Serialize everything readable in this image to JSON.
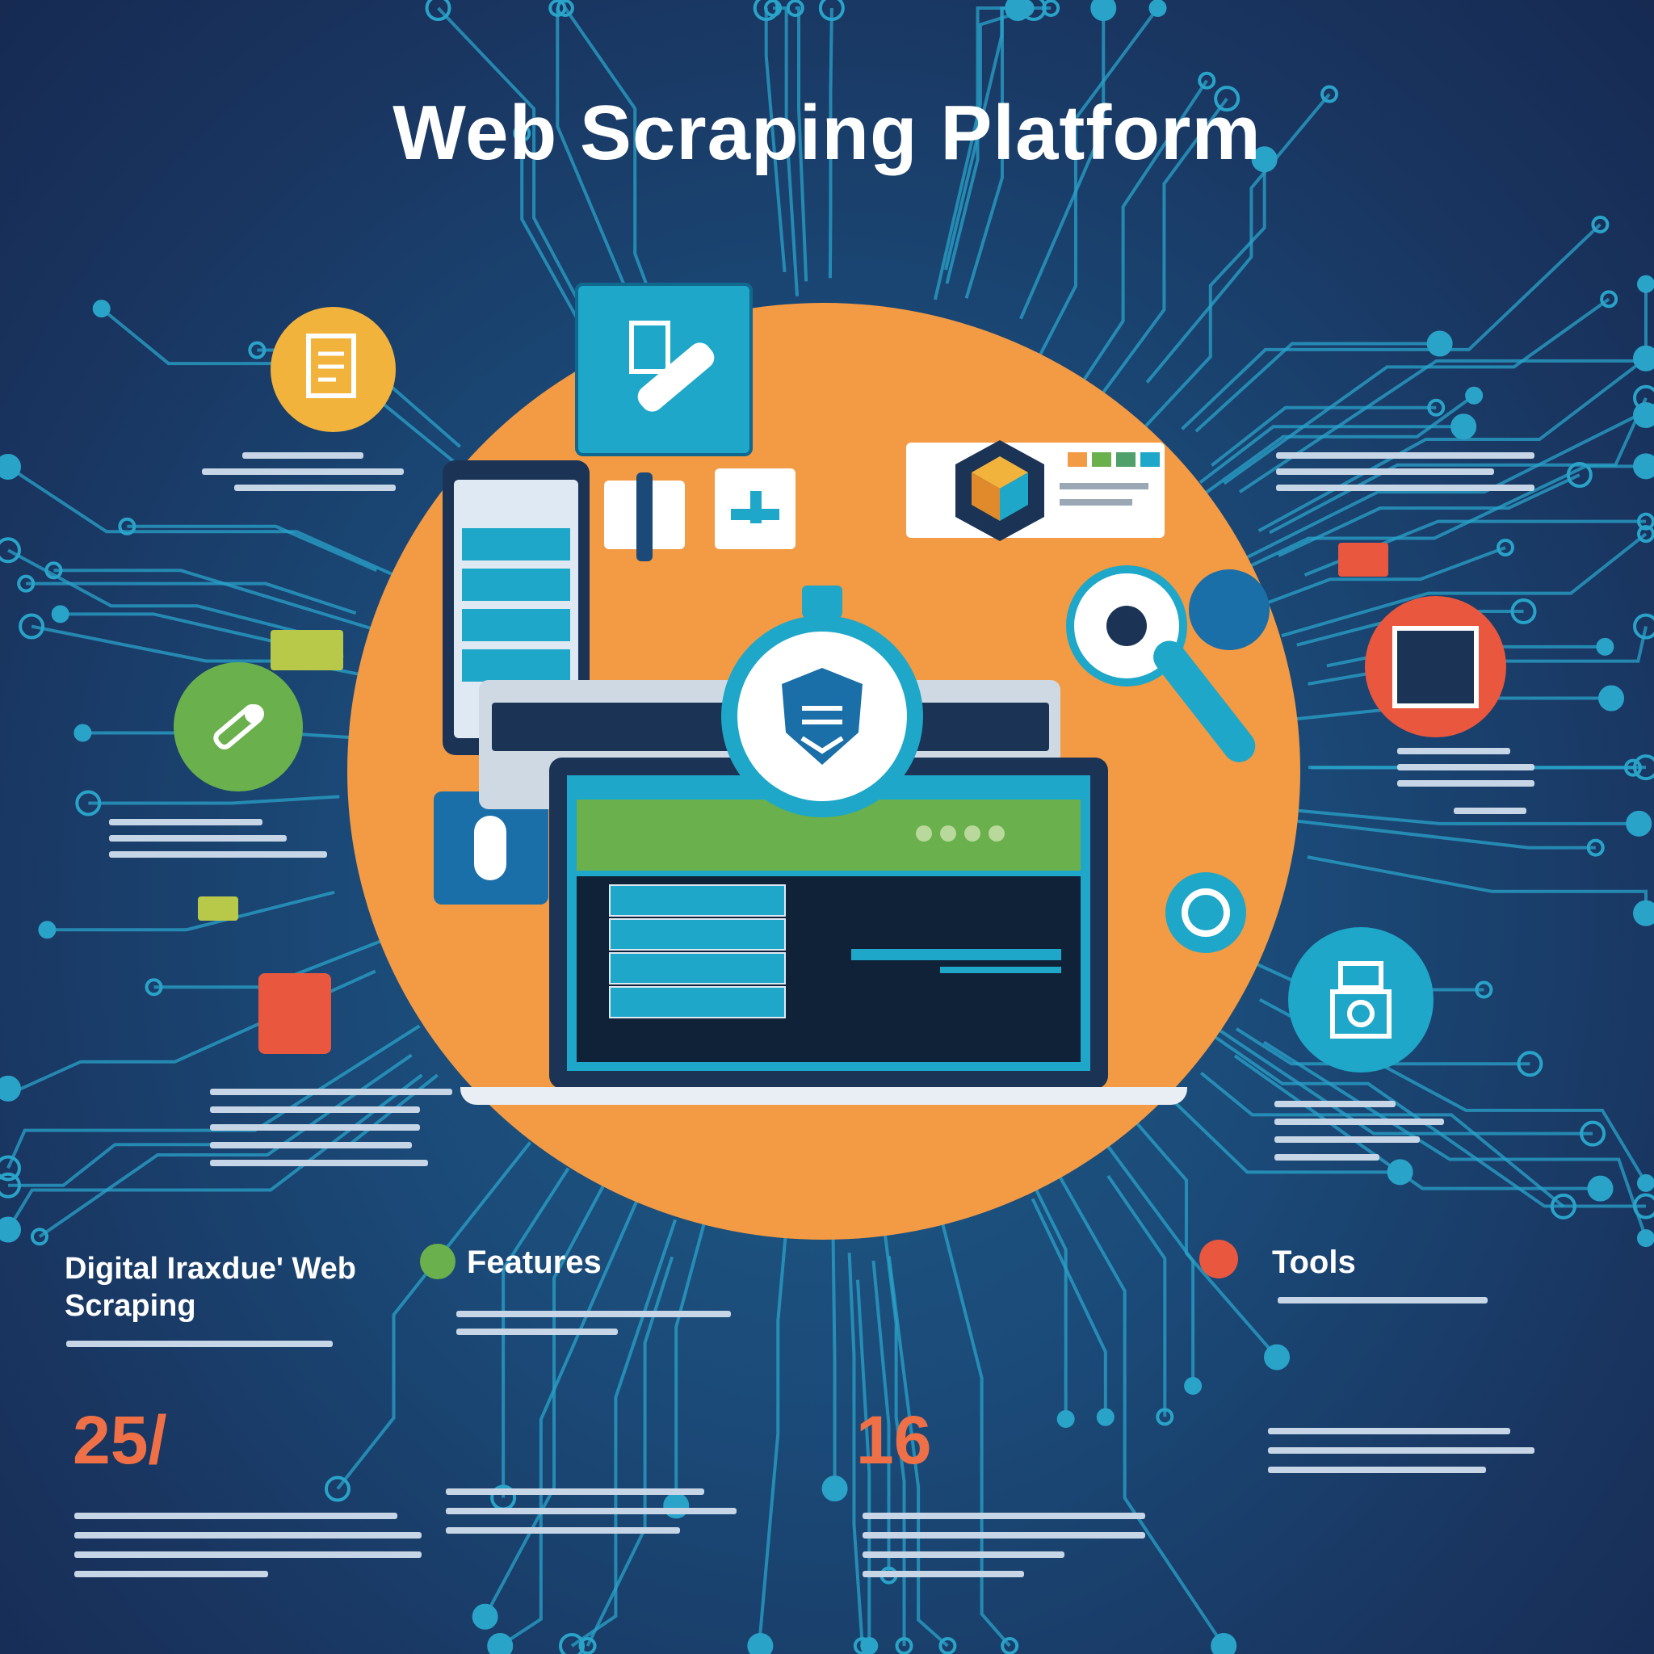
{
  "title": "Web Scraping Platform",
  "sections": {
    "left_heading": "Digital Iraxdue' Web Scraping",
    "features_heading": "Features",
    "tools_heading": "Tools"
  },
  "stats": {
    "left_value": "25/",
    "middle_value": "16"
  },
  "colors": {
    "background": "#1b4a78",
    "circuit": "#2aa3c9",
    "accent_orange": "#f39a44",
    "accent_yellow": "#f2b33d",
    "accent_green": "#6ab04c",
    "accent_red": "#e9573f",
    "accent_cyan": "#1ea7c8"
  },
  "icons": [
    "document-icon",
    "ruler-icon",
    "wrench-icon",
    "shield-stopwatch-icon",
    "magnifier-icon",
    "cube-icon",
    "robot-icon",
    "gear-icon",
    "calculator-icon"
  ]
}
